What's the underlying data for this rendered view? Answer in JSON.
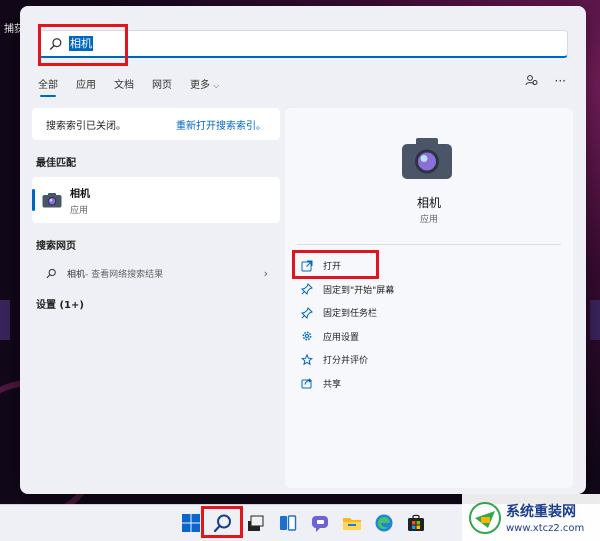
{
  "desktop": {
    "label": "捕获"
  },
  "search": {
    "query": "相机"
  },
  "tabs": [
    {
      "label": "全部",
      "active": true
    },
    {
      "label": "应用"
    },
    {
      "label": "文档"
    },
    {
      "label": "网页"
    },
    {
      "label": "更多"
    }
  ],
  "toolbar": {
    "more_label": "···"
  },
  "notice": {
    "text": "搜索索引已关闭。",
    "link": "重新打开搜索索引。"
  },
  "best_match": {
    "title": "最佳匹配",
    "name": "相机",
    "type": "应用"
  },
  "web": {
    "title": "搜索网页",
    "term": "相机",
    "suffix": " - 查看网络搜索结果"
  },
  "settings": {
    "label": "设置 (1+)"
  },
  "detail": {
    "name": "相机",
    "type": "应用",
    "actions": [
      {
        "label": "打开",
        "icon": "open-external-icon"
      },
      {
        "label": "固定到\"开始\"屏幕",
        "icon": "pin-icon"
      },
      {
        "label": "固定到任务栏",
        "icon": "pin-icon"
      },
      {
        "label": "应用设置",
        "icon": "gear-icon"
      },
      {
        "label": "打分并评价",
        "icon": "star-icon"
      },
      {
        "label": "共享",
        "icon": "share-icon"
      }
    ]
  },
  "watermark": {
    "title": "系统重装网",
    "url": "www.xtcz2.com"
  },
  "colors": {
    "accent": "#0067c0",
    "highlight": "#e0161e"
  }
}
